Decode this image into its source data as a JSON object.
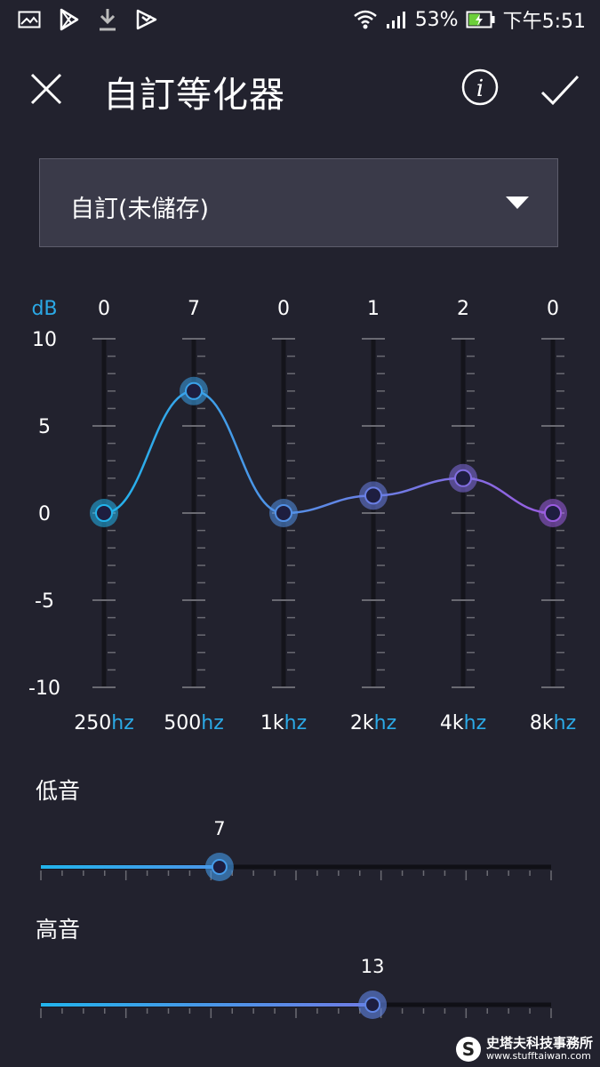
{
  "status_bar": {
    "left_icons": [
      "image-icon",
      "play-store-icon",
      "download-icon",
      "play-games-icon"
    ],
    "wifi_icon": "wifi-icon",
    "signal_icon": "signal-icon",
    "battery_percent": "53%",
    "battery_level": 0.53,
    "time": "下午5:51"
  },
  "app_bar": {
    "title": "自訂等化器",
    "close_icon": "close-icon",
    "info_icon": "info-icon",
    "confirm_icon": "check-icon"
  },
  "preset": {
    "selected": "自訂(未儲存)",
    "dropdown_icon": "caret-down-icon"
  },
  "equalizer": {
    "unit_label": "dB",
    "y_axis_ticks": [
      "10",
      "5",
      "0",
      "-5",
      "-10"
    ],
    "y_range": [
      -10,
      10
    ],
    "bands": [
      {
        "freq_num": "250",
        "freq_unit": "hz",
        "value": 0,
        "value_label": "0"
      },
      {
        "freq_num": "500",
        "freq_unit": "hz",
        "value": 7,
        "value_label": "7"
      },
      {
        "freq_num": "1k",
        "freq_unit": "hz",
        "value": 0,
        "value_label": "0"
      },
      {
        "freq_num": "2k",
        "freq_unit": "hz",
        "value": 1,
        "value_label": "1"
      },
      {
        "freq_num": "4k",
        "freq_unit": "hz",
        "value": 2,
        "value_label": "2"
      },
      {
        "freq_num": "8k",
        "freq_unit": "hz",
        "value": 0,
        "value_label": "0"
      }
    ],
    "colors": {
      "start": "#22b4ec",
      "end": "#9a5ce0",
      "axis_text": "#ffffff",
      "unit_text": "#2ba9e6",
      "track": "#14141b",
      "tick": "#6a6a72"
    }
  },
  "bass": {
    "label": "低音",
    "value_label": "7",
    "fraction": 0.35
  },
  "treble": {
    "label": "高音",
    "value_label": "13",
    "fraction": 0.65
  },
  "watermark": {
    "name_cn": "史塔夫科技事務所",
    "url": "www.stufftaiwan.com"
  }
}
